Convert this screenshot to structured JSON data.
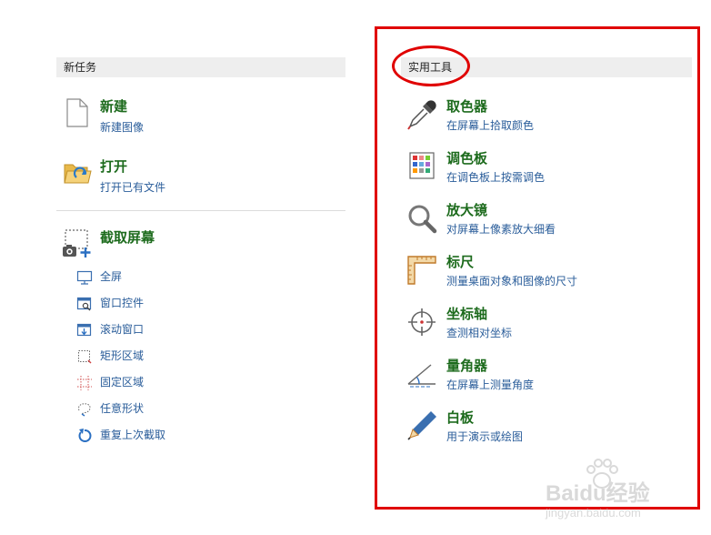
{
  "left_panel": {
    "header": "新任务",
    "new": {
      "title": "新建",
      "subtitle": "新建图像",
      "icon": "blank-document-icon"
    },
    "open": {
      "title": "打开",
      "subtitle": "打开已有文件",
      "icon": "open-folder-icon"
    },
    "capture": {
      "title": "截取屏幕",
      "icon": "screen-capture-icon",
      "items": [
        {
          "label": "全屏",
          "icon": "monitor-icon"
        },
        {
          "label": "窗口控件",
          "icon": "window-control-icon"
        },
        {
          "label": "滚动窗口",
          "icon": "scroll-window-icon"
        },
        {
          "label": "矩形区域",
          "icon": "rectangle-region-icon"
        },
        {
          "label": "固定区域",
          "icon": "fixed-region-icon"
        },
        {
          "label": "任意形状",
          "icon": "freeform-shape-icon"
        },
        {
          "label": "重复上次截取",
          "icon": "repeat-capture-icon"
        }
      ]
    }
  },
  "right_panel": {
    "header": "实用工具",
    "tools": [
      {
        "title": "取色器",
        "subtitle": "在屏幕上拾取颜色",
        "icon": "eyedropper-icon"
      },
      {
        "title": "调色板",
        "subtitle": "在调色板上按需调色",
        "icon": "color-palette-icon"
      },
      {
        "title": "放大镜",
        "subtitle": "对屏幕上像素放大细看",
        "icon": "magnifier-icon"
      },
      {
        "title": "标尺",
        "subtitle": "测量桌面对象和图像的尺寸",
        "icon": "ruler-icon"
      },
      {
        "title": "坐标轴",
        "subtitle": "查测相对坐标",
        "icon": "crosshair-icon"
      },
      {
        "title": "量角器",
        "subtitle": "在屏幕上测量角度",
        "icon": "protractor-icon"
      },
      {
        "title": "白板",
        "subtitle": "用于演示或绘图",
        "icon": "pen-icon"
      }
    ]
  },
  "colors": {
    "title_green": "#1d6b1d",
    "link_blue": "#2a5d9a",
    "highlight_red": "#e00000",
    "header_bg": "#eeeeee"
  },
  "watermark": {
    "text": "Baidu经验",
    "subtext": "jingyan.baidu.com"
  }
}
